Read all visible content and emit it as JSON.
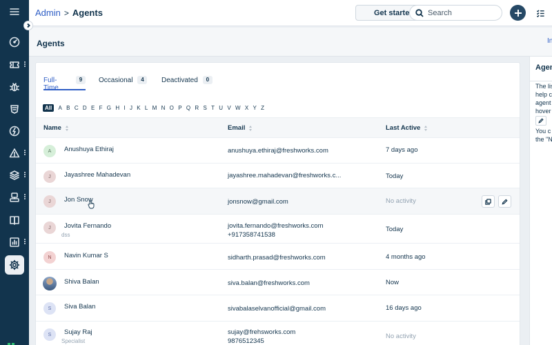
{
  "breadcrumb": {
    "parent": "Admin",
    "separator": ">",
    "current": "Agents"
  },
  "header": {
    "get_started_label": "Get started",
    "search_placeholder": "Search"
  },
  "page": {
    "title": "Agents",
    "right_link_cut": "In"
  },
  "tabs": [
    {
      "label": "Full-Time",
      "count": "9",
      "active": true
    },
    {
      "label": "Occasional",
      "count": "4",
      "active": false
    },
    {
      "label": "Deactivated",
      "count": "0",
      "active": false
    }
  ],
  "alphabet": [
    "All",
    "A",
    "B",
    "C",
    "D",
    "E",
    "F",
    "G",
    "H",
    "I",
    "J",
    "K",
    "L",
    "M",
    "N",
    "O",
    "P",
    "Q",
    "R",
    "S",
    "T",
    "U",
    "V",
    "W",
    "X",
    "Y",
    "Z"
  ],
  "table": {
    "columns": {
      "name": "Name",
      "email": "Email",
      "last_active": "Last Active"
    },
    "rows": [
      {
        "initial": "A",
        "name": "Anushuya Ethiraj",
        "subtitle": "",
        "email": "anushuya.ethiraj@freshworks.com",
        "email2": "",
        "last_active": "7 days ago"
      },
      {
        "initial": "J",
        "name": "Jayashree Mahadevan",
        "subtitle": "",
        "email": "jayashree.mahadevan@freshworks.c...",
        "email2": "",
        "last_active": "Today"
      },
      {
        "initial": "J",
        "name": "Jon Snow",
        "subtitle": "",
        "email": "jonsnow@gmail.com",
        "email2": "",
        "last_active": "No activity"
      },
      {
        "initial": "J",
        "name": "Jovita Fernando",
        "subtitle": "dss",
        "email": "jovita.fernando@freshworks.com",
        "email2": "+917358741538",
        "last_active": "Today"
      },
      {
        "initial": "N",
        "name": "Navin Kumar S",
        "subtitle": "",
        "email": "sidharth.prasad@freshworks.com",
        "email2": "",
        "last_active": "4 months ago"
      },
      {
        "initial": "",
        "name": "Shiva Balan",
        "subtitle": "",
        "email": "siva.balan@freshworks.com",
        "email2": "",
        "last_active": "Now"
      },
      {
        "initial": "S",
        "name": "Siva Balan",
        "subtitle": "",
        "email": "sivabalaselvanofficial@gmail.com",
        "email2": "",
        "last_active": "16 days ago"
      },
      {
        "initial": "S",
        "name": "Sujay Raj",
        "subtitle": "Specialist",
        "email": "sujay@frehsworks.com",
        "email2": "9876512345",
        "last_active": "No activity"
      }
    ]
  },
  "sidepanel": {
    "title": "Agents",
    "lines": [
      "The list",
      "help c",
      "agent",
      "hover",
      "You c",
      "the \"N"
    ]
  },
  "icons": {
    "nav": [
      "dashboard-icon",
      "tickets-icon",
      "problems-icon",
      "changes-icon",
      "releases-icon",
      "alerts-icon",
      "assets-icon",
      "projects-icon",
      "solutions-icon",
      "reports-icon",
      "admin-icon"
    ]
  },
  "colors": {
    "nav_bg": "#12344d",
    "accent": "#2c5cc5",
    "add_button": "#264966"
  }
}
